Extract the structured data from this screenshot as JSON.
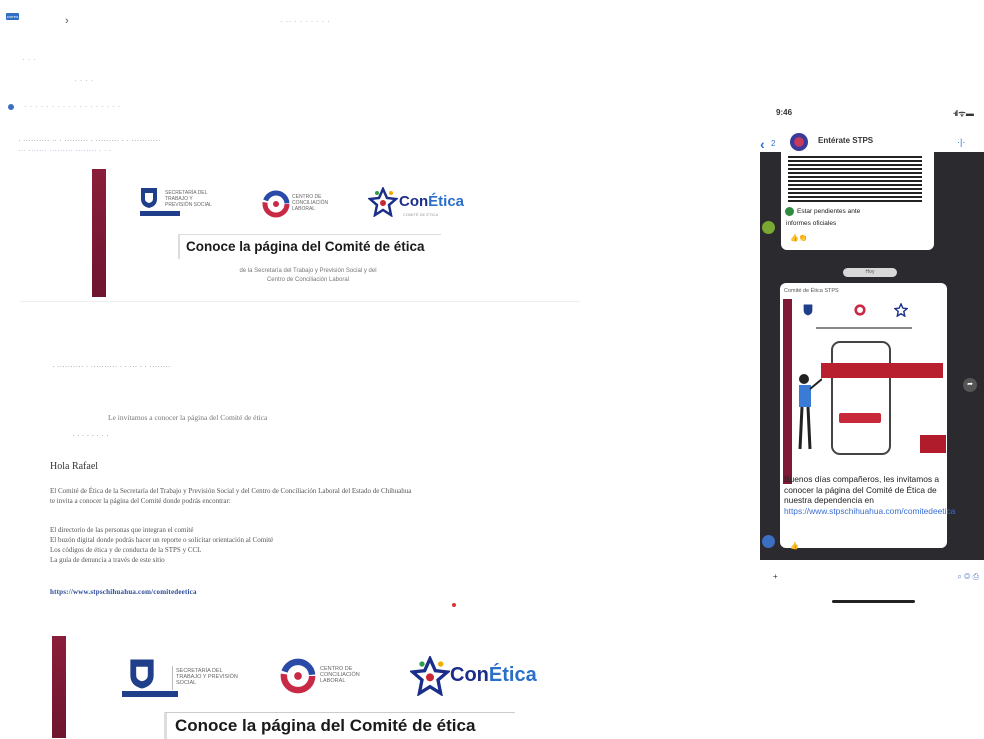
{
  "email_header": {
    "tag_label": "correo",
    "faint_top_text": "· ·· · · ·  · ·   · ·",
    "faint_line_2": "· · ·",
    "faint_line_3": "· · · ·",
    "faint_line_4": "· · · · · · · · · · · · · · · · · ·",
    "sender_line_1": "· ·········· ·· · ········· · ········· · · ···········",
    "sender_line_2": "··· ······· ·········   ········ · · ·"
  },
  "banner": {
    "title": "Conoce la página del Comité de ética",
    "subtitle_line1": "de la Secretaría del Trabajo y Previsión Social y del",
    "subtitle_line2": "Centro de Conciliación Laboral",
    "logo1_text": "SECRETARÍA DEL TRABAJO Y PREVISIÓN SOCIAL",
    "logo2_text": "CENTRO DE CONCILIACIÓN LABORAL",
    "conetica_con": "Con",
    "conetica_etica": "Ética",
    "conetica_tagline": "COMITÉ DE ÉTICA"
  },
  "email_body": {
    "faint_line_a": "· ··········   · ·········· · · ··· ·  · ········",
    "faint_line_b": "Le invitamos a conocer la página del Comité de ética",
    "faint_line_c": "· · · · · · · ·",
    "greeting": "Hola Rafael",
    "paragraph_line1": "El Comité de Ética de la Secretaría del Trabajo y Previsión Social y del Centro de Conciliación Laboral del Estado de Chihuahua",
    "paragraph_line2": "te invita a conocer la página del Comité donde podrás encontrar:",
    "list_line1": "El directorio de las personas que integran el comité",
    "list_line2": "El buzón digital donde podrás hacer un reporte o solicitar orientación al Comité",
    "list_line3": "Los códigos de ética y de conducta de la STPS y CCL",
    "list_line4": "La guía de denuncia a través de este sitio",
    "link": "https://www.stpschihuahua.com/comitedeetica"
  },
  "banner2": {
    "title": "Conoce la página del Comité de ética",
    "conetica_con": "Con",
    "conetica_etica": "Ética"
  },
  "phone": {
    "time": "9:46",
    "status_icons": "·ıl ᯤ ▬",
    "back": "‹",
    "back_count": "2",
    "chat_name": "Entérate STPS",
    "chat_call": "·|·",
    "top_bubble_line1": "Estar pendientes ante",
    "top_bubble_line2": "informes oficiales",
    "top_bubble_reactions": "👍👏",
    "day_label": "Hoy",
    "main_bubble_header": "Comité de Ética STPS",
    "main_bubble_text": "Buenos días compañeros, les invitamos a conocer la página del Comité de Ética de nuestra dependencia en",
    "main_bubble_link": "https://www.stpschihuahua.com/comitedeetica",
    "main_bubble_reaction": "👍",
    "bottom_left": "+",
    "bottom_right": "⌕ ◎ ⎙"
  },
  "colors": {
    "maroon": "#7e1a35",
    "conetica_blue": "#1b2f8a",
    "chat_background": "#2b2b2f",
    "link_blue": "#3b6ed6"
  }
}
